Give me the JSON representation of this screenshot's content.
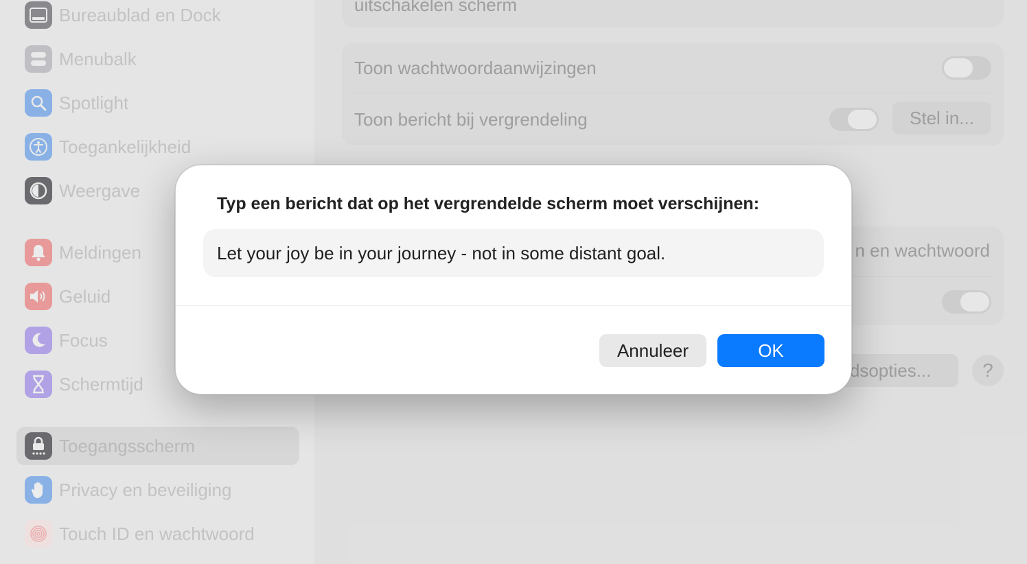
{
  "sidebar": {
    "items": [
      {
        "label": "Bureaublad en Dock",
        "icon": "dock-icon",
        "color": "#8e8e93"
      },
      {
        "label": "Menubalk",
        "icon": "menubar-icon",
        "color": "#c7c7cc"
      },
      {
        "label": "Spotlight",
        "icon": "spotlight-search-icon",
        "color": "#8fb9f0"
      },
      {
        "label": "Toegankelijkheid",
        "icon": "accessibility-icon",
        "color": "#8fb9f0"
      },
      {
        "label": "Weergave",
        "icon": "appearance-icon",
        "color": "#6e6e73"
      },
      {
        "label": "Meldingen",
        "icon": "notifications-bell-icon",
        "color": "#f2a0a0"
      },
      {
        "label": "Geluid",
        "icon": "sound-speaker-icon",
        "color": "#f2a0a0"
      },
      {
        "label": "Focus",
        "icon": "focus-moon-icon",
        "color": "#b8a9ef"
      },
      {
        "label": "Schermtijd",
        "icon": "screentime-hourglass-icon",
        "color": "#b8a9ef"
      },
      {
        "label": "Toegangsscherm",
        "icon": "lock-screen-icon",
        "color": "#6e6e73",
        "selected": true
      },
      {
        "label": "Privacy en beveiliging",
        "icon": "privacy-hand-icon",
        "color": "#8fb9f0"
      },
      {
        "label": "Touch ID en wachtwoord",
        "icon": "touchid-fingerprint-icon",
        "color": "#f5c2c2"
      }
    ]
  },
  "main": {
    "top_partial_label": "uitschakelen scherm",
    "show_password_hints_label": "Toon wachtwoordaanwijzingen",
    "show_message_label": "Toon bericht bij vergrendeling",
    "set_button_label": "Stel in...",
    "partial_row_label": "n en wachtwoord",
    "partial_button_label": "eidsopties...",
    "help_label": "?"
  },
  "dialog": {
    "title": "Typ een bericht dat op het vergrendelde scherm moet verschijnen:",
    "message_value": "Let your joy be in your journey - not in some distant goal.",
    "cancel_label": "Annuleer",
    "ok_label": "OK",
    "accent_color": "#0a7aff"
  }
}
